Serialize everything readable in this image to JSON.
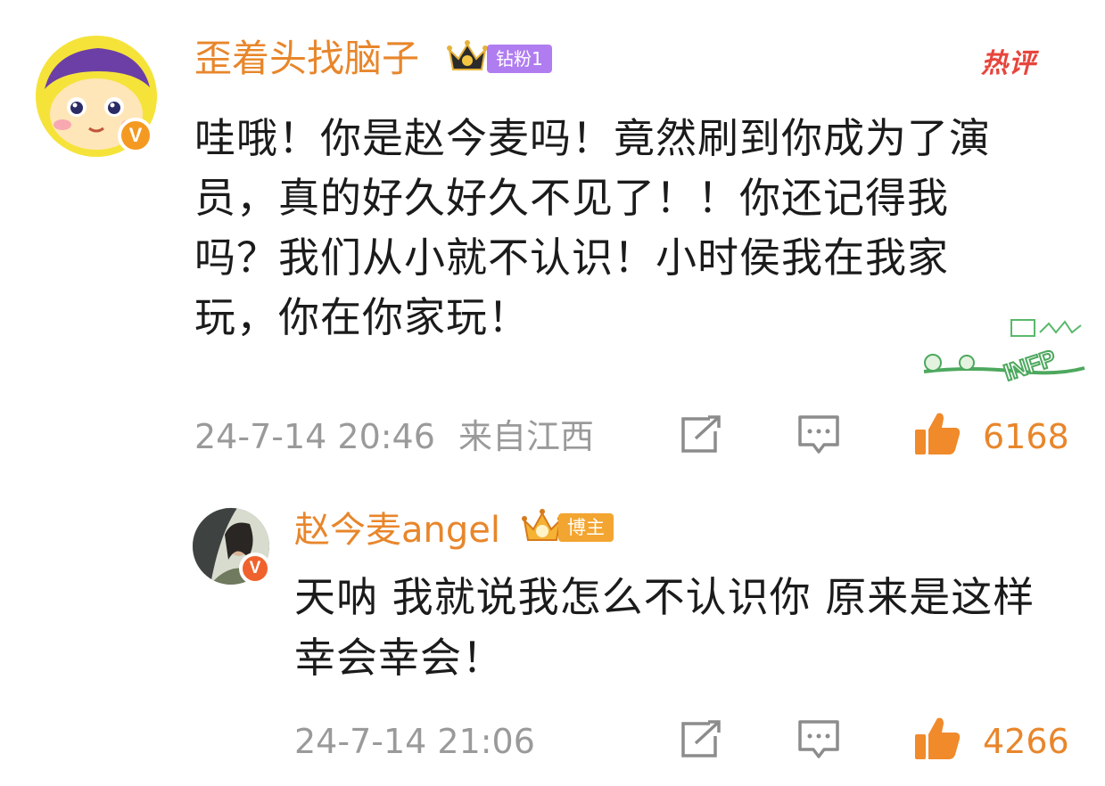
{
  "comments": [
    {
      "username": "歪着头找脑子",
      "badge": "钻粉1",
      "hot_label": "热评",
      "text": "哇哦！你是赵今麦吗！竟然刷到你成为了演员，真的好久好久不见了！！你还记得我吗？我们从小就不认识！小时侯我在我家玩，你在你家玩！",
      "sticker_text": "INFP",
      "timestamp": "24-7-14 20:46",
      "location": "来自江西",
      "likes": "6168"
    }
  ],
  "reply": {
    "username": "赵今麦angel",
    "badge": "博主",
    "text": "天呐 我就说我怎么不认识你 原来是这样 幸会幸会！",
    "timestamp": "24-7-14 21:06",
    "likes": "4266"
  },
  "colors": {
    "username": "#e8862b",
    "like_orange": "#f08a2b",
    "fan_badge": "#b07df0",
    "blogger_badge": "#f3a531",
    "hot_label": "#e7453c"
  }
}
